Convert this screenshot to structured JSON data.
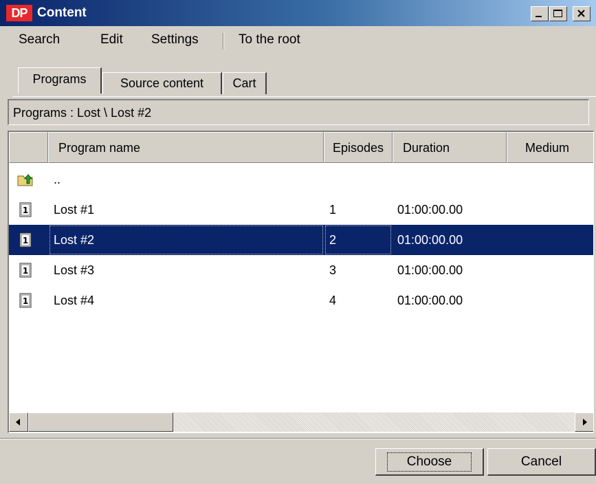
{
  "window": {
    "title": "Content",
    "logo_text": "DP"
  },
  "titlebar_buttons": {
    "minimize": "minimize",
    "maximize": "maximize",
    "close": "close"
  },
  "menu": {
    "search": "Search",
    "edit": "Edit",
    "settings": "Settings",
    "to_root": "To the root"
  },
  "tabs": [
    {
      "label": "Programs",
      "active": true
    },
    {
      "label": "Source content",
      "active": false
    },
    {
      "label": "Cart",
      "active": false
    }
  ],
  "breadcrumb": "Programs : Lost \\ Lost #2",
  "grid": {
    "columns": {
      "icon": "",
      "name": "Program name",
      "episodes": "Episodes",
      "duration": "Duration",
      "medium": "Medium"
    },
    "parent_row": {
      "icon": "folder-up-icon",
      "label": ".."
    },
    "rows": [
      {
        "icon": "program-info-icon",
        "name": "Lost #1",
        "episodes": "1",
        "duration": "01:00:00.00",
        "medium": ""
      },
      {
        "icon": "program-info-icon",
        "name": "Lost #2",
        "episodes": "2",
        "duration": "01:00:00.00",
        "medium": "",
        "selected": true
      },
      {
        "icon": "program-info-icon",
        "name": "Lost #3",
        "episodes": "3",
        "duration": "01:00:00.00",
        "medium": ""
      },
      {
        "icon": "program-info-icon",
        "name": "Lost #4",
        "episodes": "4",
        "duration": "01:00:00.00",
        "medium": ""
      }
    ]
  },
  "buttons": {
    "choose": "Choose",
    "cancel": "Cancel"
  },
  "colors": {
    "selection": "#0a246a",
    "title_start": "#0a246a",
    "title_end": "#a6caf0",
    "logo": "#e8282b",
    "face": "#d4d0c8"
  }
}
